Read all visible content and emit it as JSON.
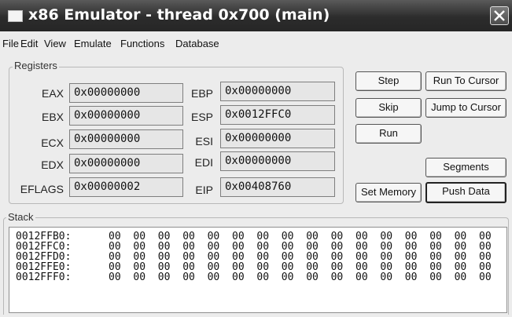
{
  "window": {
    "title": "x86 Emulator - thread 0x700 (main)",
    "icons": {
      "app": "window-icon",
      "close": "close-icon"
    }
  },
  "menu": {
    "items": [
      "File",
      "Edit",
      "View",
      "Emulate",
      "Functions",
      "Database"
    ]
  },
  "registers": {
    "legend": "Registers",
    "left": [
      {
        "label": "EAX",
        "value": "0x00000000"
      },
      {
        "label": "EBX",
        "value": "0x00000000"
      },
      {
        "label": "ECX",
        "value": "0x00000000"
      },
      {
        "label": "EDX",
        "value": "0x00000000"
      },
      {
        "label": "EFLAGS",
        "value": "0x00000002"
      }
    ],
    "right": [
      {
        "label": "EBP",
        "value": "0x00000000"
      },
      {
        "label": "ESP",
        "value": "0x0012FFC0"
      },
      {
        "label": "ESI",
        "value": "0x00000000"
      },
      {
        "label": "EDI",
        "value": "0x00000000"
      },
      {
        "label": "EIP",
        "value": "0x00408760"
      }
    ]
  },
  "buttons": {
    "step": "Step",
    "run_to_cursor": "Run To Cursor",
    "skip": "Skip",
    "jump_to_cursor": "Jump to Cursor",
    "run": "Run",
    "segments": "Segments",
    "set_memory": "Set Memory",
    "push_data": "Push Data"
  },
  "stack": {
    "legend": "Stack",
    "rows": [
      {
        "addr": "0012FFB0:",
        "bytes": [
          "00",
          "00",
          "00",
          "00",
          "00",
          "00",
          "00",
          "00",
          "00",
          "00",
          "00",
          "00",
          "00",
          "00",
          "00",
          "00"
        ]
      },
      {
        "addr": "0012FFC0:",
        "bytes": [
          "00",
          "00",
          "00",
          "00",
          "00",
          "00",
          "00",
          "00",
          "00",
          "00",
          "00",
          "00",
          "00",
          "00",
          "00",
          "00"
        ]
      },
      {
        "addr": "0012FFD0:",
        "bytes": [
          "00",
          "00",
          "00",
          "00",
          "00",
          "00",
          "00",
          "00",
          "00",
          "00",
          "00",
          "00",
          "00",
          "00",
          "00",
          "00"
        ]
      },
      {
        "addr": "0012FFE0:",
        "bytes": [
          "00",
          "00",
          "00",
          "00",
          "00",
          "00",
          "00",
          "00",
          "00",
          "00",
          "00",
          "00",
          "00",
          "00",
          "00",
          "00"
        ]
      },
      {
        "addr": "0012FFF0:",
        "bytes": [
          "00",
          "00",
          "00",
          "00",
          "00",
          "00",
          "00",
          "00",
          "00",
          "00",
          "00",
          "00",
          "00",
          "00",
          "00",
          "00"
        ]
      }
    ]
  }
}
